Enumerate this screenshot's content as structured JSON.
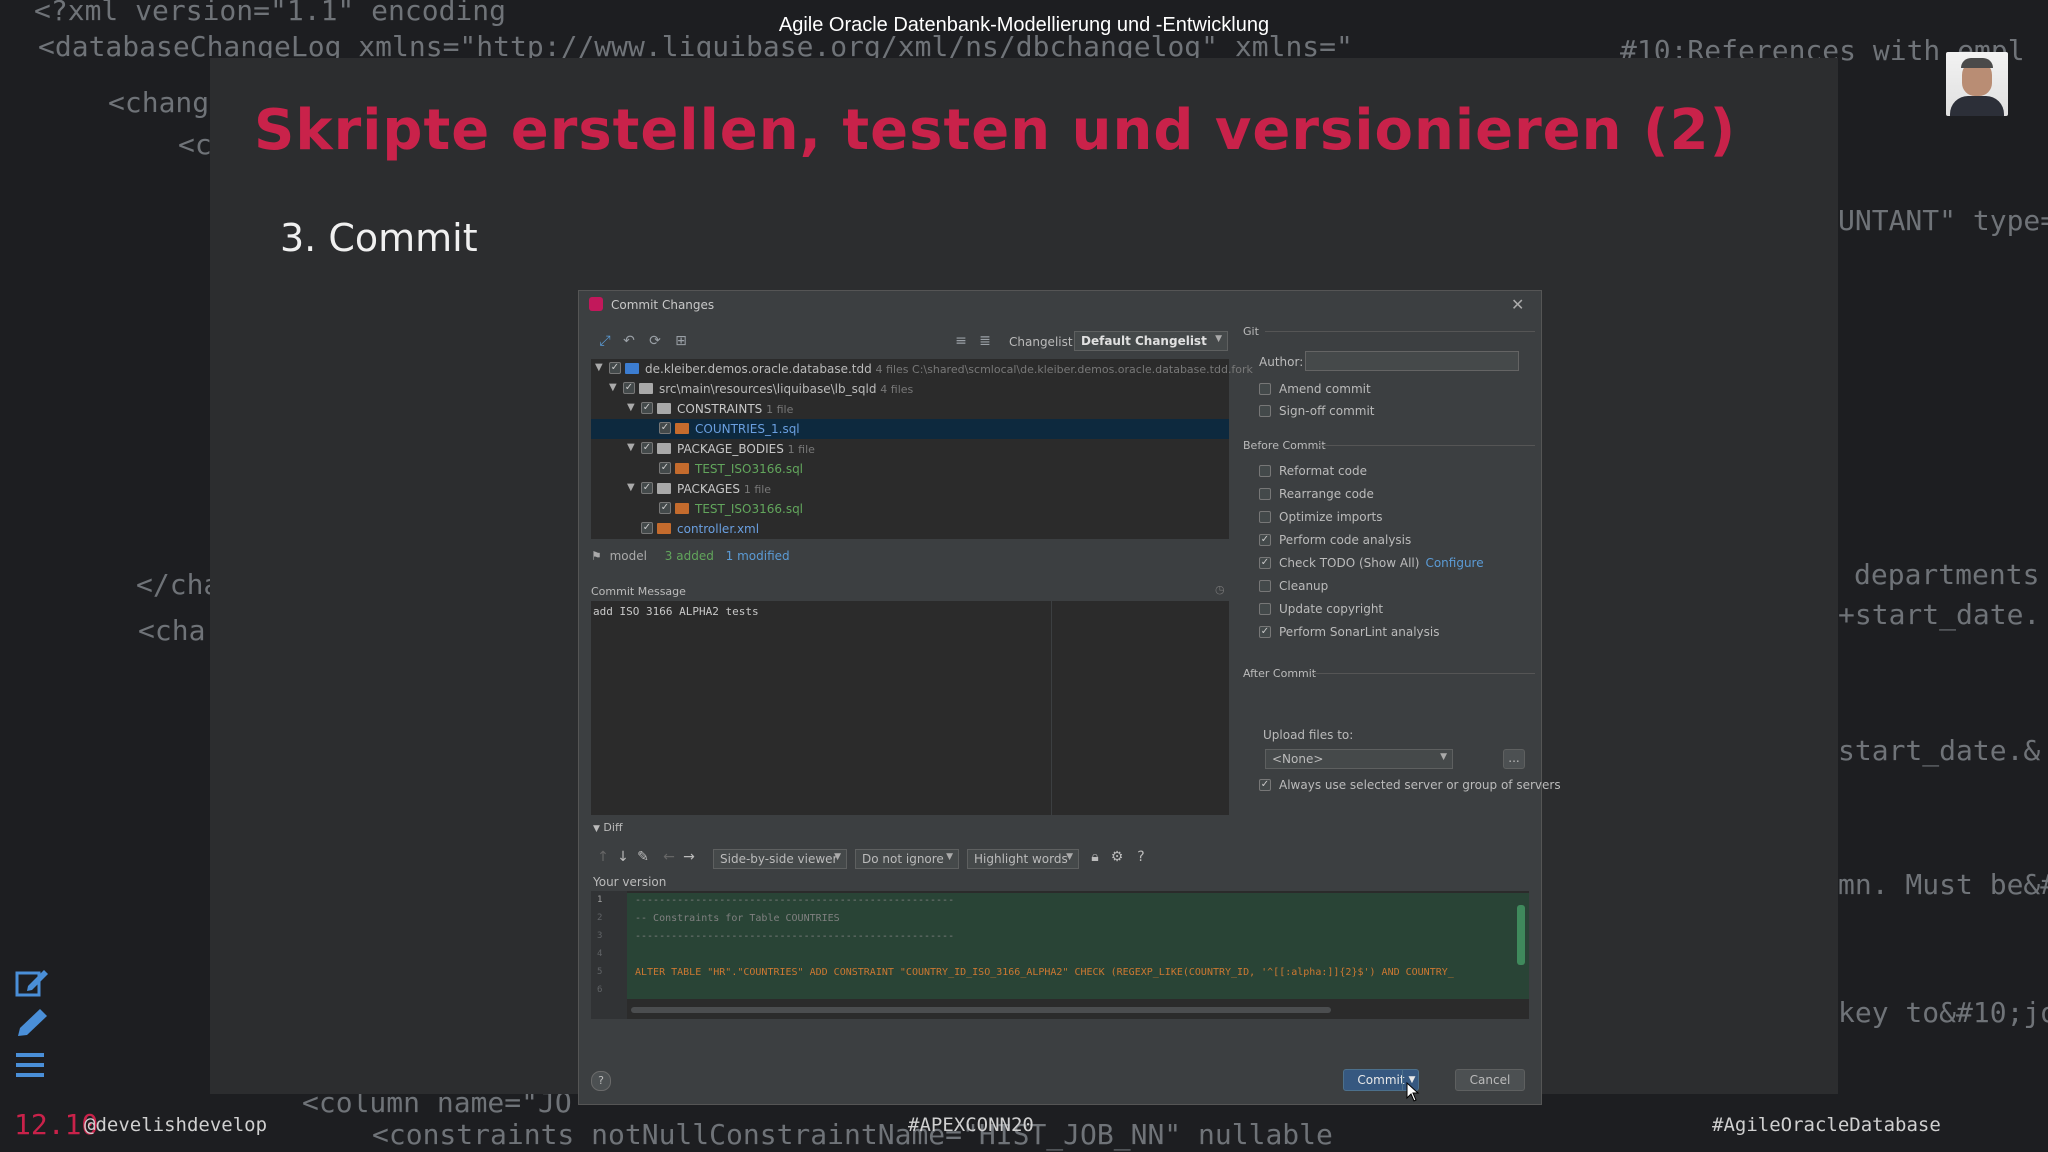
{
  "header": {
    "title": "Agile Oracle Datenbank-Modellierung und -Entwicklung"
  },
  "slide": {
    "title": "Skripte erstellen, testen und versionieren (2)",
    "subtitle": "3. Commit"
  },
  "background_code": [
    "<?xml version=\"1.1\" encoding",
    "<databaseChangeLog xmlns=\"http://www.liquibase.org/xml/ns/dbchangelog\" xmlns=\"",
    "<chang",
    "<c",
    "</cha",
    "<cha",
    "#10;References with empl",
    "UNTANT\" type=",
    "departments",
    "+start_date.",
    "start_date.&",
    "mn. Must be&#",
    "key to&#10;jo",
    "<column name=\"JO",
    "<constraints notNullConstraintName=\"HIST_JOB_NN\" nullable"
  ],
  "bottom": {
    "time": "12.10",
    "handle": "@develishdevelop",
    "hashtag_mid": "#APEXCONN20",
    "hashtag_right": "#AgileOracleDatabase"
  },
  "dialog": {
    "title": "Commit Changes",
    "changelist_label": "Changelist:",
    "changelist_value": "Default Changelist",
    "git_label": "Git",
    "tree": [
      {
        "name": "de.kleiber.demos.oracle.database.tdd",
        "meta": "4 files  C:\\shared\\scmlocal\\de.kleiber.demos.oracle.database.tdd.fork"
      },
      {
        "name": "src\\main\\resources\\liquibase\\lb_sqld",
        "meta": "4 files"
      },
      {
        "name": "CONSTRAINTS",
        "meta": "1 file"
      },
      {
        "name": "COUNTRIES_1.sql",
        "meta": ""
      },
      {
        "name": "PACKAGE_BODIES",
        "meta": "1 file"
      },
      {
        "name": "TEST_ISO3166.sql",
        "meta": ""
      },
      {
        "name": "PACKAGES",
        "meta": "1 file"
      },
      {
        "name": "TEST_ISO3166.sql",
        "meta": ""
      },
      {
        "name": "controller.xml",
        "meta": ""
      }
    ],
    "status": {
      "branch": "model",
      "added": "3 added",
      "modified": "1 modified"
    },
    "commit_message_label": "Commit Message",
    "commit_message": "add ISO 3166 ALPHA2 tests",
    "author_label": "Author:",
    "author_value": "",
    "git_options": [
      {
        "label": "Amend commit",
        "checked": false
      },
      {
        "label": "Sign-off commit",
        "checked": false
      }
    ],
    "before_commit_label": "Before Commit",
    "before_commit": [
      {
        "label": "Reformat code",
        "checked": false
      },
      {
        "label": "Rearrange code",
        "checked": false
      },
      {
        "label": "Optimize imports",
        "checked": false
      },
      {
        "label": "Perform code analysis",
        "checked": true
      },
      {
        "label": "Check TODO (Show All)",
        "checked": true,
        "link": "Configure"
      },
      {
        "label": "Cleanup",
        "checked": false
      },
      {
        "label": "Update copyright",
        "checked": false
      },
      {
        "label": "Perform SonarLint analysis",
        "checked": true
      }
    ],
    "after_commit_label": "After Commit",
    "upload_label": "Upload files to:",
    "upload_value": "<None>",
    "upload_browse": "...",
    "always_use_label": "Always use selected server or group of servers",
    "always_use_checked": true,
    "diff_label": "Diff",
    "diff_viewer": "Side-by-side viewer",
    "diff_ignore": "Do not ignore",
    "diff_highlight": "Highlight words",
    "your_version_label": "Your version",
    "code_lines": [
      {
        "n": "1",
        "text": "-----------------------------------------------------"
      },
      {
        "n": "2",
        "text": "--  Constraints for Table COUNTRIES"
      },
      {
        "n": "3",
        "text": "-----------------------------------------------------"
      },
      {
        "n": "4",
        "text": ""
      },
      {
        "n": "5",
        "text": "  ALTER TABLE \"HR\".\"COUNTRIES\" ADD CONSTRAINT \"COUNTRY_ID_ISO_3166_ALPHA2\" CHECK (REGEXP_LIKE(COUNTRY_ID, '^[[:alpha:]]{2}$') AND COUNTRY_"
      },
      {
        "n": "6",
        "text": ""
      }
    ],
    "commit_button": "Commit",
    "cancel_button": "Cancel",
    "help": "?"
  }
}
